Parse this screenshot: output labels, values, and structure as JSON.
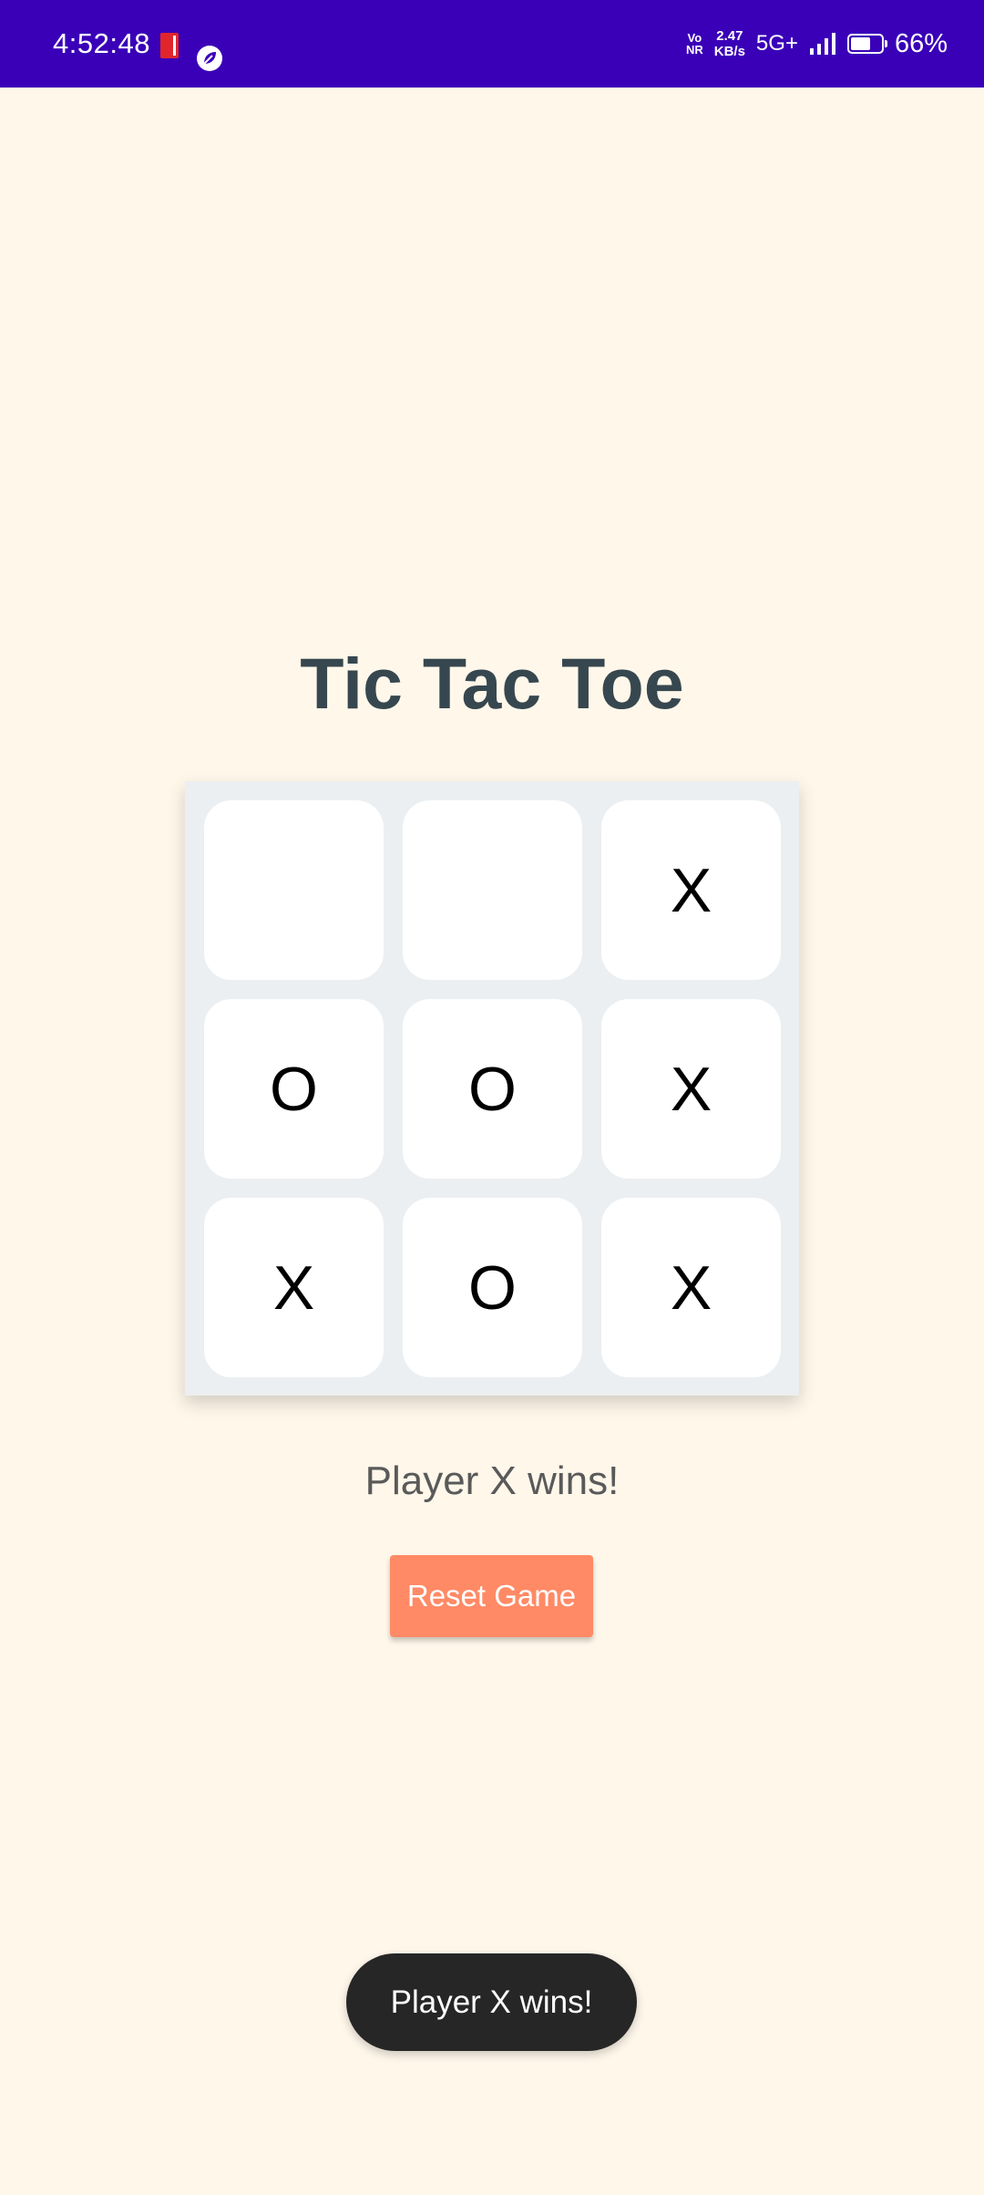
{
  "status_bar": {
    "time": "4:52:48",
    "vonr_top": "Vo",
    "vonr_bottom": "NR",
    "net_speed_value": "2.47",
    "net_speed_unit": "KB/s",
    "network_type": "5G+",
    "battery_percent": "66%",
    "battery_level": 0.66
  },
  "app": {
    "title": "Tic Tac Toe"
  },
  "board": {
    "cells": [
      "",
      "",
      "X",
      "O",
      "O",
      "X",
      "X",
      "O",
      "X"
    ]
  },
  "game_status": "Player X wins!",
  "reset_label": "Reset Game",
  "toast": "Player X wins!",
  "colors": {
    "status_bar": "#3A00B8",
    "background": "#FFF7EA",
    "title": "#37474F",
    "board_bg": "#ECEFF1",
    "reset_button": "#FF8A65",
    "toast_bg": "#262626"
  }
}
